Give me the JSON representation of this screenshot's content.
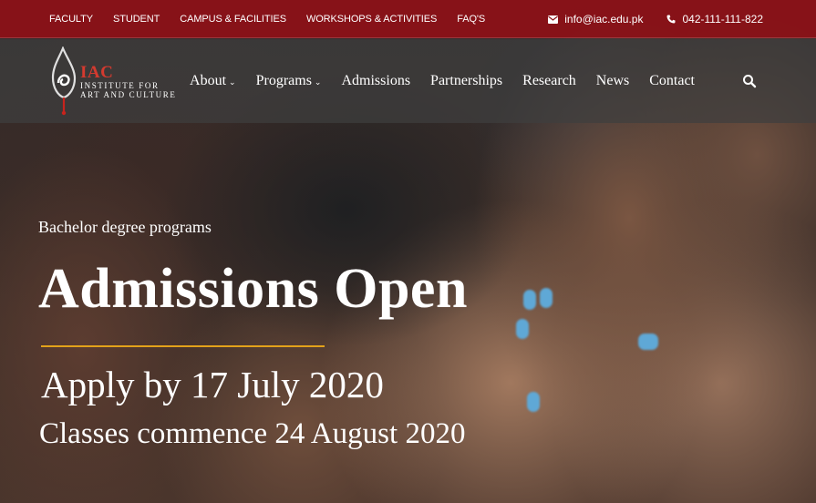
{
  "topbar": {
    "links": [
      "FACULTY",
      "STUDENT",
      "CAMPUS & FACILITIES",
      "WORKSHOPS & ACTIVITIES",
      "FAQ'S"
    ],
    "email": "info@iac.edu.pk",
    "phone": "042-111-111-822",
    "email_icon": "envelope-icon",
    "phone_icon": "phone-icon"
  },
  "logo": {
    "abbr": "IAC",
    "line1": "INSTITUTE FOR",
    "line2": "ART AND CULTURE"
  },
  "nav": {
    "items": [
      {
        "label": "About",
        "dropdown": true
      },
      {
        "label": "Programs",
        "dropdown": true
      },
      {
        "label": "Admissions",
        "dropdown": false
      },
      {
        "label": "Partnerships",
        "dropdown": false
      },
      {
        "label": "Research",
        "dropdown": false
      },
      {
        "label": "News",
        "dropdown": false
      },
      {
        "label": "Contact",
        "dropdown": false
      }
    ],
    "search_icon": "search-icon"
  },
  "hero": {
    "kicker": "Bachelor degree programs",
    "headline": "Admissions Open",
    "apply": "Apply by 17 July 2020",
    "classes": "Classes commence 24 August 2020"
  },
  "colors": {
    "topbar": "#8a1218",
    "accent_rule": "#e3a21a",
    "logo_red": "#d43a2f"
  }
}
